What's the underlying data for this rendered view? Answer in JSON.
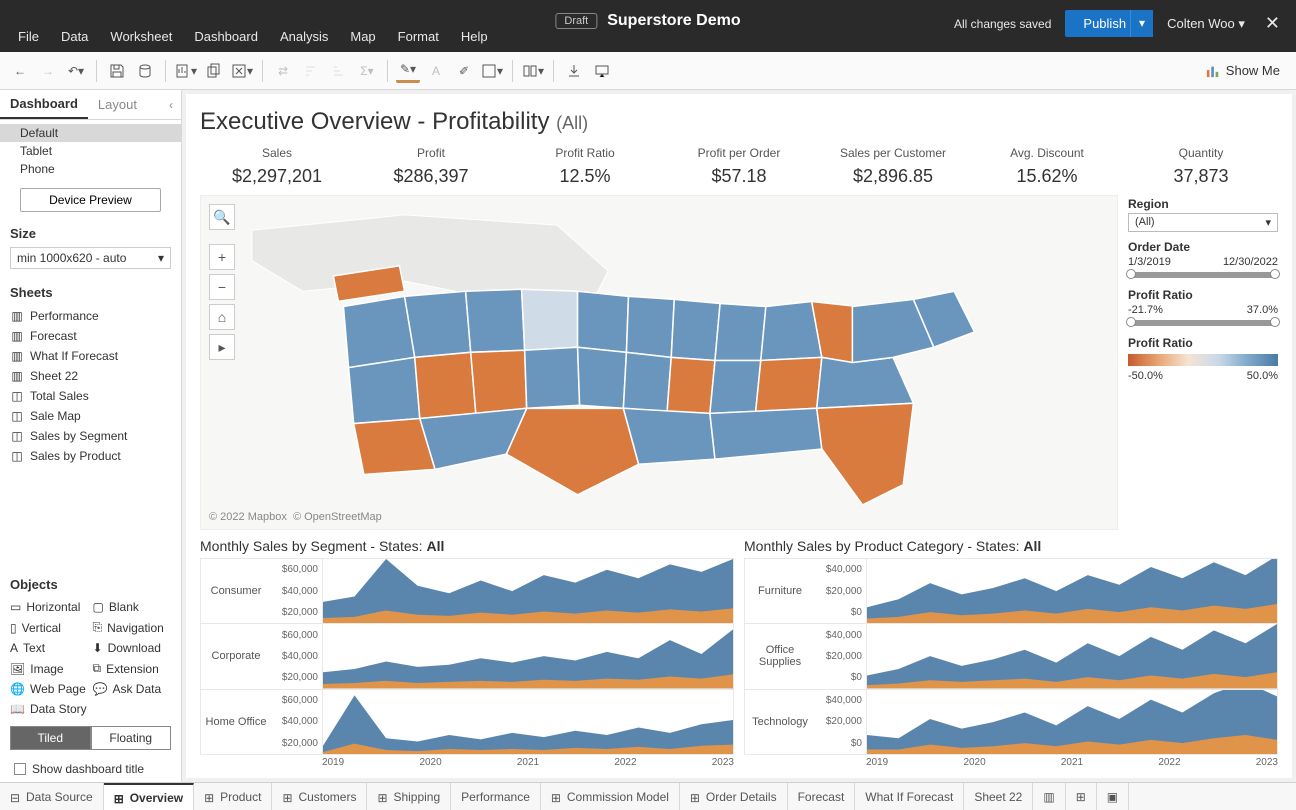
{
  "app": {
    "draft_label": "Draft",
    "doc_title": "Superstore Demo",
    "save_status": "All changes saved",
    "publish_label": "Publish",
    "user": "Colten Woo",
    "showme": "Show Me"
  },
  "menu": [
    "File",
    "Data",
    "Worksheet",
    "Dashboard",
    "Analysis",
    "Map",
    "Format",
    "Help"
  ],
  "side": {
    "tab_dashboard": "Dashboard",
    "tab_layout": "Layout",
    "devices": [
      "Default",
      "Tablet",
      "Phone"
    ],
    "device_preview": "Device Preview",
    "size_h": "Size",
    "size_val": "min 1000x620 - auto",
    "sheets_h": "Sheets",
    "sheets": [
      "Performance",
      "Forecast",
      "What If Forecast",
      "Sheet 22",
      "Total Sales",
      "Sale Map",
      "Sales by Segment",
      "Sales by Product"
    ],
    "objects_h": "Objects",
    "objects": [
      "Horizontal",
      "Blank",
      "Vertical",
      "Navigation",
      "Text",
      "Download",
      "Image",
      "Extension",
      "Web Page",
      "Ask Data",
      "Data Story"
    ],
    "tiled": "Tiled",
    "floating": "Floating",
    "show_title": "Show dashboard title"
  },
  "dash": {
    "title": "Executive Overview - Profitability",
    "title_sub": "(All)",
    "kpis": [
      {
        "label": "Sales",
        "value": "$2,297,201"
      },
      {
        "label": "Profit",
        "value": "$286,397"
      },
      {
        "label": "Profit Ratio",
        "value": "12.5%"
      },
      {
        "label": "Profit per Order",
        "value": "$57.18"
      },
      {
        "label": "Sales per Customer",
        "value": "$2,896.85"
      },
      {
        "label": "Avg. Discount",
        "value": "15.62%"
      },
      {
        "label": "Quantity",
        "value": "37,873"
      }
    ],
    "map_attr1": "© 2022 Mapbox",
    "map_attr2": "© OpenStreetMap",
    "filters": {
      "region_h": "Region",
      "region_val": "(All)",
      "date_h": "Order Date",
      "date_min": "1/3/2019",
      "date_max": "12/30/2022",
      "ratio_h": "Profit Ratio",
      "ratio_min": "-21.7%",
      "ratio_max": "37.0%",
      "legend_h": "Profit Ratio",
      "legend_min": "-50.0%",
      "legend_max": "50.0%"
    },
    "seg_title_a": "Monthly Sales by Segment - States: ",
    "seg_title_b": "All",
    "seg_rows": [
      "Consumer",
      "Corporate",
      "Home Office"
    ],
    "seg_axis": [
      "$60,000",
      "$40,000",
      "$20,000"
    ],
    "prod_title_a": "Monthly Sales by Product Category - States: ",
    "prod_title_b": "All",
    "prod_rows": [
      "Furniture",
      "Office Supplies",
      "Technology"
    ],
    "prod_axis": [
      "$40,000",
      "$20,000",
      "$0"
    ],
    "years": [
      "2019",
      "2020",
      "2021",
      "2022",
      "2023"
    ]
  },
  "tabs": [
    "Data Source",
    "Overview",
    "Product",
    "Customers",
    "Shipping",
    "Performance",
    "Commission Model",
    "Order Details",
    "Forecast",
    "What If Forecast",
    "Sheet 22"
  ],
  "chart_data": {
    "type": "area",
    "note": "Stacked area sparklines, approximate values read from y-axis gridlines ($). Blue = primary value, orange = secondary component beneath.",
    "x_years": [
      2019,
      2020,
      2021,
      2022,
      2023
    ],
    "segment": {
      "ylim": [
        0,
        60000
      ],
      "series": [
        {
          "name": "Consumer",
          "blue": [
            20000,
            25000,
            60000,
            35000,
            28000,
            40000,
            30000,
            45000,
            38000,
            50000,
            42000,
            55000,
            48000,
            60000
          ],
          "orange": [
            5000,
            6000,
            12000,
            8000,
            7000,
            10000,
            8000,
            11000,
            9000,
            12000,
            10000,
            13000,
            11000,
            14000
          ]
        },
        {
          "name": "Corporate",
          "blue": [
            15000,
            18000,
            25000,
            20000,
            22000,
            28000,
            24000,
            30000,
            26000,
            34000,
            28000,
            45000,
            32000,
            55000
          ],
          "orange": [
            4000,
            5000,
            7000,
            5000,
            6000,
            7000,
            6000,
            8000,
            7000,
            9000,
            8000,
            11000,
            9000,
            13000
          ]
        },
        {
          "name": "Home Office",
          "blue": [
            8000,
            55000,
            15000,
            12000,
            18000,
            14000,
            20000,
            16000,
            22000,
            18000,
            25000,
            20000,
            28000,
            32000
          ],
          "orange": [
            2000,
            10000,
            4000,
            3000,
            5000,
            4000,
            5000,
            4000,
            6000,
            5000,
            7000,
            5000,
            8000,
            9000
          ]
        }
      ]
    },
    "product": {
      "ylim": [
        0,
        40000
      ],
      "series": [
        {
          "name": "Furniture",
          "blue": [
            10000,
            15000,
            25000,
            18000,
            22000,
            28000,
            20000,
            30000,
            24000,
            35000,
            28000,
            38000,
            30000,
            42000
          ],
          "orange": [
            3000,
            4000,
            7000,
            5000,
            6000,
            8000,
            6000,
            9000,
            7000,
            10000,
            8000,
            11000,
            9000,
            12000
          ]
        },
        {
          "name": "Office Supplies",
          "blue": [
            8000,
            12000,
            20000,
            14000,
            18000,
            24000,
            16000,
            28000,
            20000,
            32000,
            24000,
            36000,
            28000,
            40000
          ],
          "orange": [
            2000,
            3000,
            5000,
            4000,
            5000,
            6000,
            4000,
            7000,
            5000,
            8000,
            6000,
            9000,
            7000,
            10000
          ]
        },
        {
          "name": "Technology",
          "blue": [
            12000,
            10000,
            22000,
            16000,
            20000,
            26000,
            18000,
            30000,
            22000,
            34000,
            26000,
            38000,
            45000,
            36000
          ],
          "orange": [
            3000,
            3000,
            6000,
            4000,
            5000,
            7000,
            5000,
            8000,
            6000,
            9000,
            7000,
            10000,
            12000,
            9000
          ]
        }
      ]
    }
  }
}
